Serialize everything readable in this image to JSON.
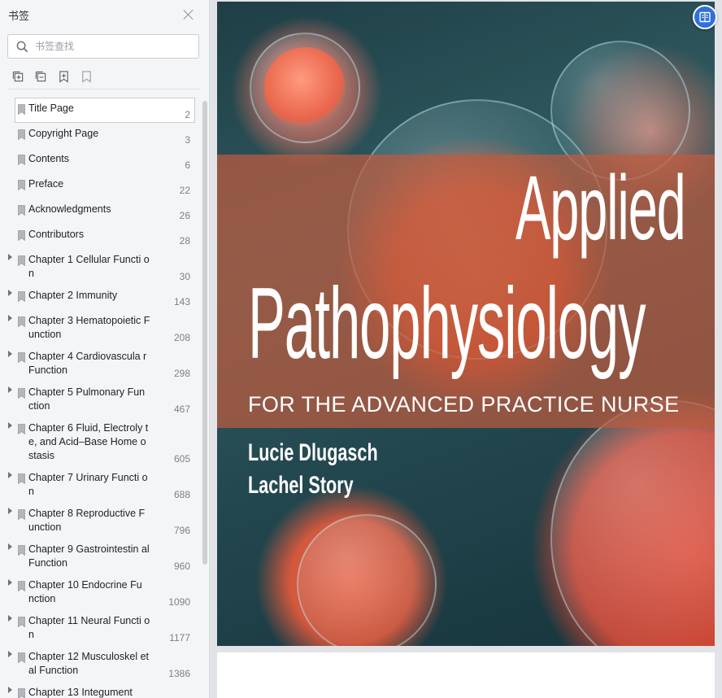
{
  "sidebar": {
    "title": "书签",
    "search_placeholder": "书签查找",
    "tools": [
      "add-bookmark-icon",
      "add-sub-bookmark-icon",
      "bookmark-add-icon",
      "bookmark-remove-icon"
    ],
    "items": [
      {
        "label": "Title Page",
        "page": "2",
        "expandable": false
      },
      {
        "label": "Copyright Page",
        "page": "3",
        "expandable": false
      },
      {
        "label": "Contents",
        "page": "6",
        "expandable": false
      },
      {
        "label": "Preface",
        "page": "22",
        "expandable": false
      },
      {
        "label": "Acknowledgments",
        "page": "26",
        "expandable": false
      },
      {
        "label": "Contributors",
        "page": "28",
        "expandable": false
      },
      {
        "label": "Chapter 1 Cellular Functi on",
        "page": "30",
        "expandable": true
      },
      {
        "label": "Chapter 2 Immunity",
        "page": "143",
        "expandable": true
      },
      {
        "label": "Chapter 3 Hematopoietic Function",
        "page": "208",
        "expandable": true
      },
      {
        "label": "Chapter 4 Cardiovascula r Function",
        "page": "298",
        "expandable": true
      },
      {
        "label": "Chapter 5 Pulmonary Fun ction",
        "page": "467",
        "expandable": true
      },
      {
        "label": "Chapter 6 Fluid, Electroly te, and Acid–Base Home ostasis",
        "page": "605",
        "expandable": true
      },
      {
        "label": "Chapter 7 Urinary Functi on",
        "page": "688",
        "expandable": true
      },
      {
        "label": "Chapter 8 Reproductive Function",
        "page": "796",
        "expandable": true
      },
      {
        "label": "Chapter 9 Gastrointestin al Function",
        "page": "960",
        "expandable": true
      },
      {
        "label": "Chapter 10 Endocrine Fu nction",
        "page": "1090",
        "expandable": true
      },
      {
        "label": "Chapter 11 Neural Functi on",
        "page": "1177",
        "expandable": true
      },
      {
        "label": "Chapter 12 Musculoskel etal Function",
        "page": "1386",
        "expandable": true
      },
      {
        "label": "Chapter 13 Integument",
        "page": "",
        "expandable": true
      }
    ]
  },
  "cover": {
    "title_line1": "Applied",
    "title_line2": "Pathophysiology",
    "subtitle": "FOR THE ADVANCED PRACTICE NURSE",
    "author1": "Lucie Dlugasch",
    "author2": "Lachel Story"
  },
  "colors": {
    "accent": "#2f6fe0",
    "band": "#be5c3e"
  }
}
